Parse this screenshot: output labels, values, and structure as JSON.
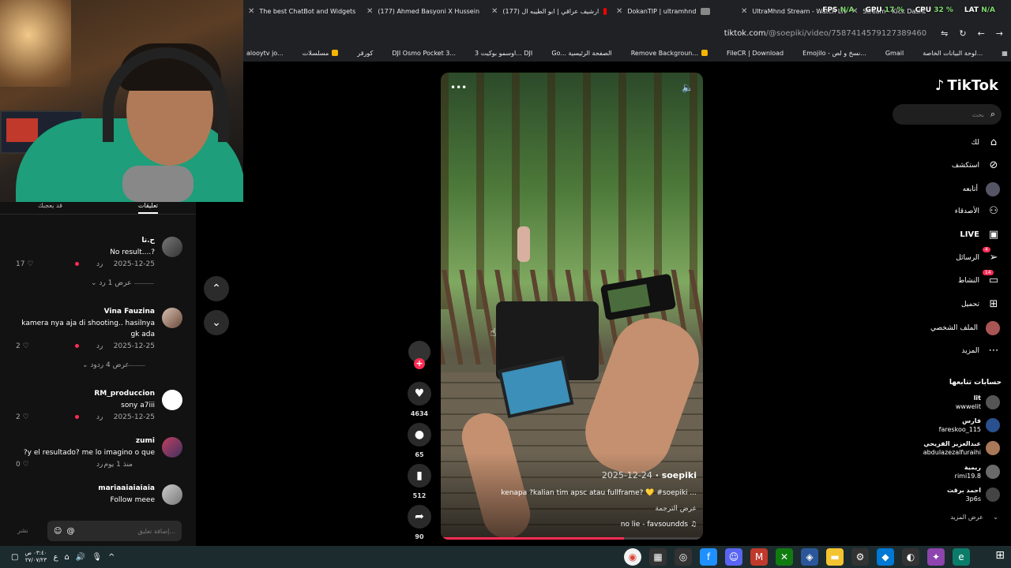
{
  "browser": {
    "tabs": [
      {
        "title": "The best ChatBot and Widgets",
        "icon": "generic-icon"
      },
      {
        "title": "(177) Ahmed Basyoni X Hussein",
        "icon": "youtube-icon"
      },
      {
        "title": "(177) ارشيف عراقي | ابو الطيبه ال",
        "icon": "youtube-icon"
      },
      {
        "title": "DokanTIP | ultramhnd",
        "icon": "generic-icon"
      },
      {
        "title": "UltraMhnd Stream - Watch Live",
        "icon": "generic-icon"
      },
      {
        "title": "Stream - Kick Dashboard",
        "icon": "kick-icon"
      }
    ],
    "url_host": "tiktok.com",
    "url_path": "/@soepiki/video/7587414579127389460",
    "bookmarks": [
      "alooytv jo...",
      "مسلسلات",
      "كورقر",
      "DJI Osmo Pocket 3...",
      "اوسمو بوكيت 3... DJI",
      "Go... الصفحة الرئيسية",
      "Remove Backgroun...",
      "FileCR | Download",
      "Emojilo - نسخ و لص...",
      "Gmail",
      "لوحة البيانات الخاصة..."
    ]
  },
  "hud": {
    "fps_label": "FPS",
    "fps_value": "N/A",
    "gpu_label": "GPU",
    "gpu_value": "17 %",
    "cpu_label": "CPU",
    "cpu_value": "32 %",
    "lat_label": "LAT",
    "lat_value": "N/A"
  },
  "comments_panel": {
    "tab_comments": "تعليقات",
    "tab_creator": "قد يعجبك",
    "comments": [
      {
        "name": "ح.تا",
        "text": "No result....?",
        "date": "2025-12-25",
        "reply": "رد",
        "likes": "17",
        "view_replies": "عرض 1 رد"
      },
      {
        "name": "Vina Fauzina",
        "text": "kamera nya aja di shooting.. hasilnya gk ada",
        "date": "2025-12-25",
        "reply": "رد",
        "likes": "2",
        "view_replies": "عرض 4 ردود"
      },
      {
        "name": "RM_produccion",
        "text": "sony a7iii",
        "date": "2025-12-25",
        "reply": "رد",
        "likes": "2"
      },
      {
        "name": "zumi",
        "text": "?y el resultado? me lo imagino o que",
        "date": "منذ 1 يوم",
        "reply": "رد",
        "likes": "0"
      },
      {
        "name": "mariaaiaiaiaia",
        "text": "Follow meee"
      }
    ],
    "input_placeholder": "إضافة تعليق...",
    "post_label": "نشر"
  },
  "video": {
    "author": "soepiki",
    "date": "2025-12-24",
    "caption": "kenapa ?kalian tim apsc atau fullframe? 💛 #soepiki ...",
    "translate": "عرض الترجمة",
    "music": "no lie - favsoundds",
    "progress": 0.7
  },
  "actions": {
    "likes": "4634",
    "comments": "65",
    "saves": "512",
    "shares": "90"
  },
  "sidebar": {
    "logo": "TikTok",
    "search_placeholder": "بحث",
    "nav": [
      {
        "label": "لك",
        "icon": "home-icon"
      },
      {
        "label": "استكشف",
        "icon": "compass-icon"
      },
      {
        "label": "أتابعه",
        "icon": "following-icon"
      },
      {
        "label": "الأصدقاء",
        "icon": "friends-icon"
      },
      {
        "label": "LIVE",
        "icon": "live-icon"
      },
      {
        "label": "الرسائل",
        "icon": "send-icon",
        "badge": "4"
      },
      {
        "label": "النشاط",
        "icon": "inbox-icon",
        "badge": "14"
      },
      {
        "label": "تحميل",
        "icon": "upload-icon"
      },
      {
        "label": "الملف الشخصي",
        "icon": "profile-icon"
      },
      {
        "label": "المزيد",
        "icon": "more-icon"
      }
    ],
    "following_title": "حسابات تتابعها",
    "following": [
      {
        "name": "lit",
        "handle": "wwwelit"
      },
      {
        "name": "فارس",
        "handle": "fareskoo_115"
      },
      {
        "name": "عبدالعزيز الفريحي",
        "handle": "abdulazezalfuraihi"
      },
      {
        "name": "ريمية",
        "handle": "rimi19.8"
      },
      {
        "name": "احمد برقت",
        "handle": "3p6s"
      }
    ],
    "show_more": "عرض المزيد"
  },
  "taskbar": {
    "time": "٠٣:٤٠ ص",
    "date": "٢٧/٠٧/٢٣",
    "lang": "ع"
  }
}
